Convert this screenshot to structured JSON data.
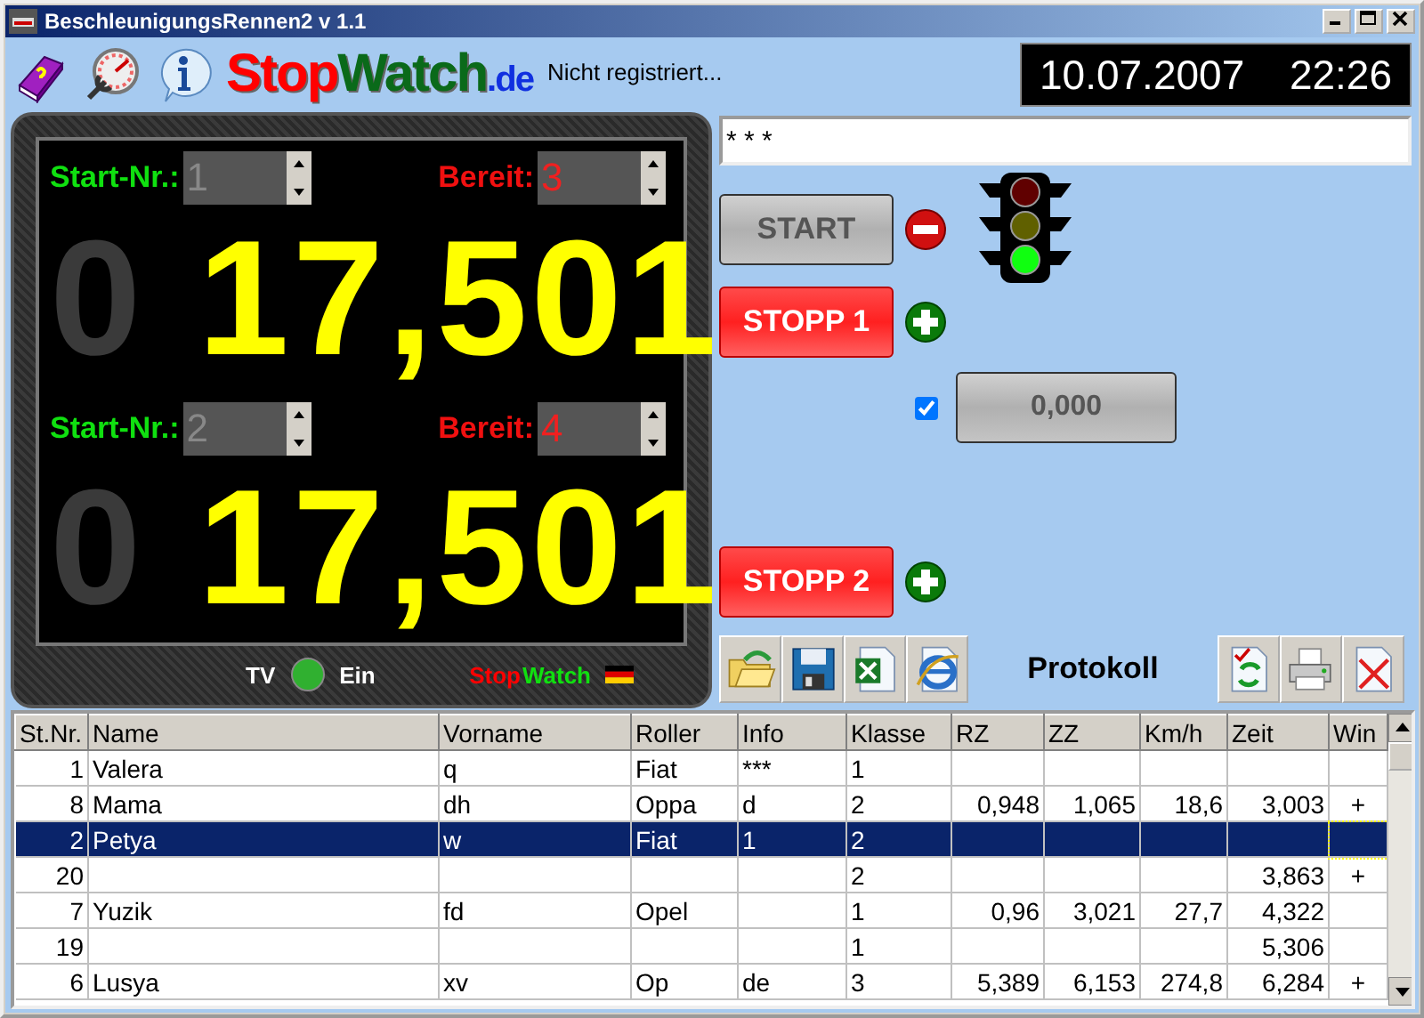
{
  "window": {
    "title": "BeschleunigungsRennen2 v 1.1"
  },
  "toolbar": {
    "logo": {
      "stop": "Stop",
      "watch": "Watch",
      "tld": ".de"
    },
    "registration": "Nicht registriert..."
  },
  "clock": {
    "date": "10.07.2007",
    "time": "22:26"
  },
  "displays": [
    {
      "start_label": "Start-Nr.:",
      "start_number": "1",
      "ready_label": "Bereit:",
      "ready_number": "3",
      "leading_digit": "0",
      "time": "17,501"
    },
    {
      "start_label": "Start-Nr.:",
      "start_number": "2",
      "ready_label": "Bereit:",
      "ready_number": "4",
      "leading_digit": "0",
      "time": "17,501"
    }
  ],
  "panel_footer": {
    "tv_label": "TV",
    "tv_on": true,
    "tv_state": "Ein",
    "brand": {
      "stop": "Stop",
      "watch": "Watch"
    }
  },
  "message_field": {
    "value": "* * *"
  },
  "start_button": {
    "label": "START",
    "disabled": true
  },
  "traffic_light": {
    "lights": [
      {
        "on": false
      },
      {
        "on": false
      },
      {
        "on": true
      }
    ]
  },
  "stop_buttons": [
    {
      "label": "STOPP 1"
    },
    {
      "label": "STOPP 2"
    }
  ],
  "offset": {
    "checked": true,
    "value": "0,000",
    "disabled": true
  },
  "protocol": {
    "title": "Protokoll"
  },
  "table": {
    "columns": [
      "St.Nr.",
      "Name",
      "Vorname",
      "Roller",
      "Info",
      "Klasse",
      "RZ",
      "ZZ",
      "Km/h",
      "Zeit",
      "Win"
    ],
    "rows": [
      {
        "selected": false,
        "cells": [
          "1",
          "Valera",
          "q",
          "Fiat",
          "***",
          "1",
          "",
          "",
          "",
          "",
          ""
        ]
      },
      {
        "selected": false,
        "cells": [
          "8",
          "Mama",
          "dh",
          "Oppa",
          "d",
          "2",
          "0,948",
          "1,065",
          "18,6",
          "3,003",
          "+"
        ]
      },
      {
        "selected": true,
        "cells": [
          "2",
          "Petya",
          "w",
          "Fiat",
          "1",
          "2",
          "",
          "",
          "",
          "",
          ""
        ]
      },
      {
        "selected": false,
        "cells": [
          "20",
          "",
          "",
          "",
          "",
          "2",
          "",
          "",
          "",
          "3,863",
          "+"
        ]
      },
      {
        "selected": false,
        "cells": [
          "7",
          "Yuzik",
          "fd",
          "Opel",
          "",
          "1",
          "0,96",
          "3,021",
          "27,7",
          "4,322",
          ""
        ]
      },
      {
        "selected": false,
        "cells": [
          "19",
          "",
          "",
          "",
          "",
          "1",
          "",
          "",
          "",
          "5,306",
          ""
        ]
      },
      {
        "selected": false,
        "cells": [
          "6",
          "Lusya",
          "xv",
          "Op",
          "de",
          "3",
          "5,389",
          "6,153",
          "274,8",
          "6,284",
          "+"
        ]
      }
    ]
  }
}
